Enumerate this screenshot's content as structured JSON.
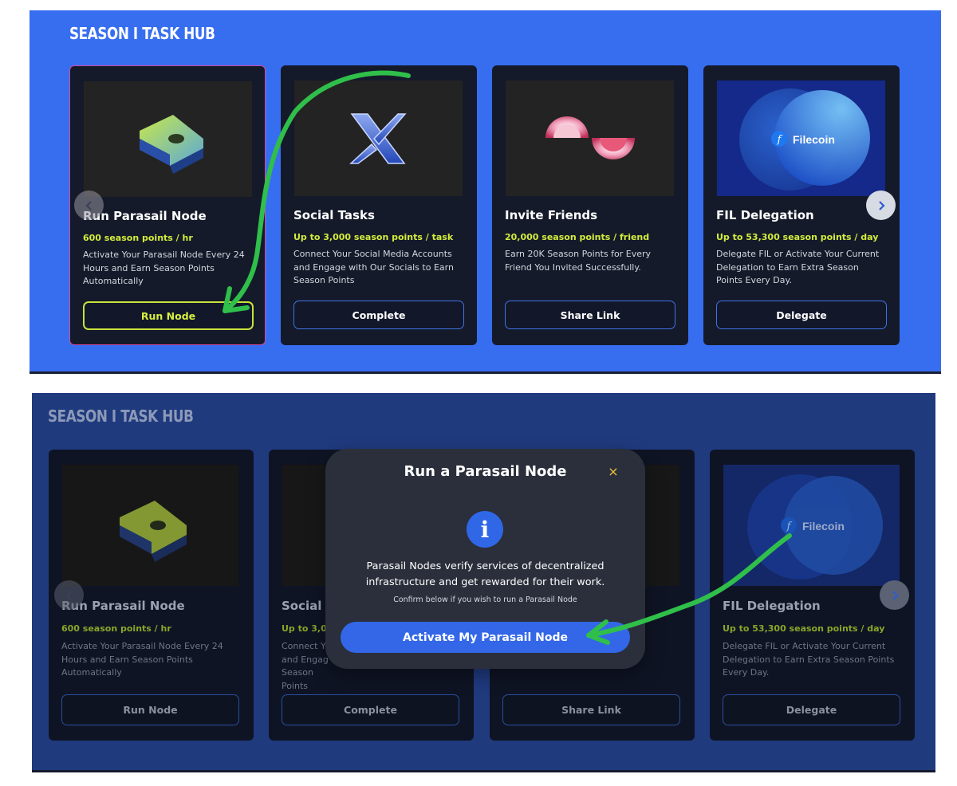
{
  "top": {
    "hub_title": "SEASON I TASK HUB",
    "cards": [
      {
        "title": "Run Parasail Node",
        "points": "600 season points / hr",
        "desc": "Activate Your Parasail Node Every 24 Hours and Earn Season Points Automatically",
        "button": "Run Node"
      },
      {
        "title": "Social Tasks",
        "points": "Up to 3,000 season points / task",
        "desc": "Connect Your Social Media Accounts and Engage with Our Socials to Earn Season Points",
        "button": "Complete"
      },
      {
        "title": "Invite Friends",
        "points": "20,000 season points / friend",
        "desc": "Earn 20K Season Points for Every Friend You Invited Successfully.",
        "button": "Share Link"
      },
      {
        "title": "FIL Delegation",
        "points": "Up to 53,300 season points / day",
        "desc": "Delegate FIL or Activate Your Current Delegation to Earn Extra Season Points Every Day.",
        "button": "Delegate",
        "logo_text": "Filecoin"
      }
    ]
  },
  "bottom": {
    "hub_title": "SEASON I TASK HUB",
    "cards": [
      {
        "title": "Run Parasail Node",
        "points": "600 season points / hr",
        "desc": "Activate Your Parasail Node Every 24 Hours and Earn Season Points Automatically",
        "button": "Run Node"
      },
      {
        "title": "Social",
        "points": "Up to 3,0",
        "desc": "Connect Y and Engag Season Points",
        "button": "Complete"
      },
      {
        "title": "",
        "points": "",
        "desc": "y Friend",
        "button": "Share Link"
      },
      {
        "title": "FIL Delegation",
        "points": "Up to 53,300 season points / day",
        "desc": "Delegate FIL or Activate Your Current Delegation to Earn Extra Season Points Every Day.",
        "button": "Delegate",
        "logo_text": "Filecoin"
      }
    ]
  },
  "modal": {
    "title": "Run a Parasail Node",
    "close": "×",
    "info_icon": "i",
    "text": "Parasail Nodes verify services of decentralized infrastructure and get rewarded for their work.",
    "sub": "Confirm below if you wish to run a Parasail Node",
    "button": "Activate My Parasail Node"
  },
  "icons": {
    "nav_left": "chevron-left-icon",
    "nav_right": "chevron-right-icon",
    "close": "close-icon",
    "info": "info-icon"
  },
  "colors": {
    "top_bg": "#376ef0",
    "bottom_bg": "#203a7e",
    "card_bg": "#151a2a",
    "accent_lime": "#d2ec3c",
    "button_blue": "#3367e8",
    "annotation_green": "#2fbf4a",
    "close_yellow": "#ecc43a"
  }
}
